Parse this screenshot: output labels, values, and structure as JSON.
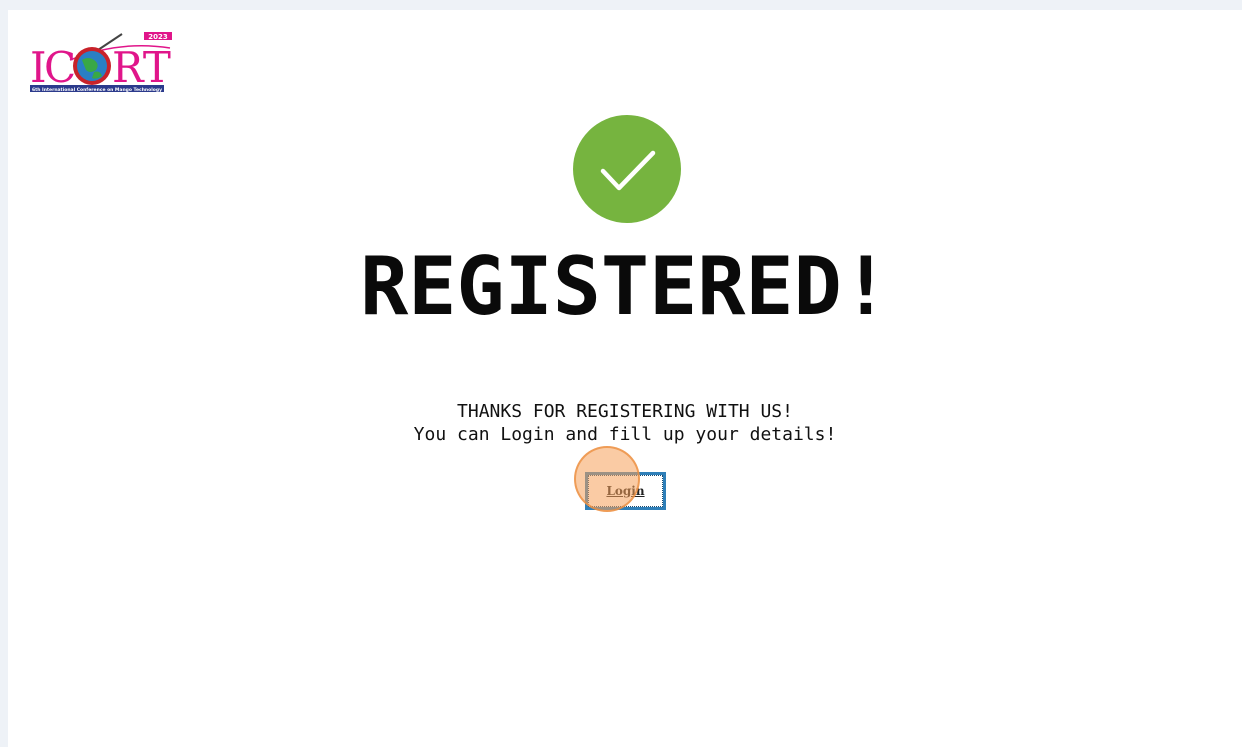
{
  "logo": {
    "text": "ICORT",
    "caption": "6th International Conference on Mango Technology",
    "badge": "2023",
    "colors": {
      "text": "#e0158a",
      "caption_bg": "#2b3a8c"
    }
  },
  "status_icon": {
    "name": "checkmark-icon",
    "color": "#76b43f"
  },
  "title": "REGISTERED!",
  "message": {
    "line1": "THANKS FOR REGISTERING WITH US!",
    "line2": "You can Login and fill up your details!"
  },
  "login_button": {
    "label": "Login"
  }
}
